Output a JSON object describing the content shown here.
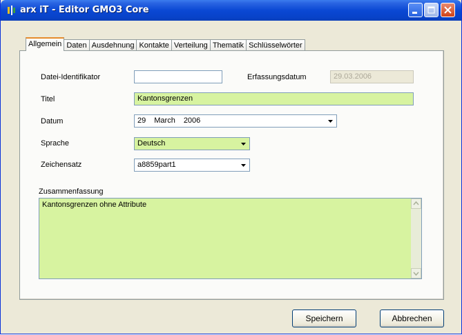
{
  "window": {
    "title": "arx iT - Editor GMO3 Core"
  },
  "tabs": [
    "Allgemein",
    "Daten",
    "Ausdehnung",
    "Kontakte",
    "Verteilung",
    "Thematik",
    "Schlüsselwörter"
  ],
  "form": {
    "file_id_label": "Datei-Identifikator",
    "file_id_value": "",
    "capture_date_label": "Erfassungsdatum",
    "capture_date_value": "29.03.2006",
    "title_label": "Titel",
    "title_value": "Kantonsgrenzen",
    "date_label": "Datum",
    "date_day": "29",
    "date_month": "March",
    "date_year": "2006",
    "language_label": "Sprache",
    "language_value": "Deutsch",
    "charset_label": "Zeichensatz",
    "charset_value": "a8859part1",
    "summary_label": "Zusammenfassung",
    "summary_value": "Kantonsgrenzen ohne Attribute"
  },
  "buttons": {
    "save": "Speichern",
    "cancel": "Abbrechen"
  },
  "colors": {
    "field_highlight": "#d7f3a0",
    "titlebar": "#0a48d4"
  }
}
